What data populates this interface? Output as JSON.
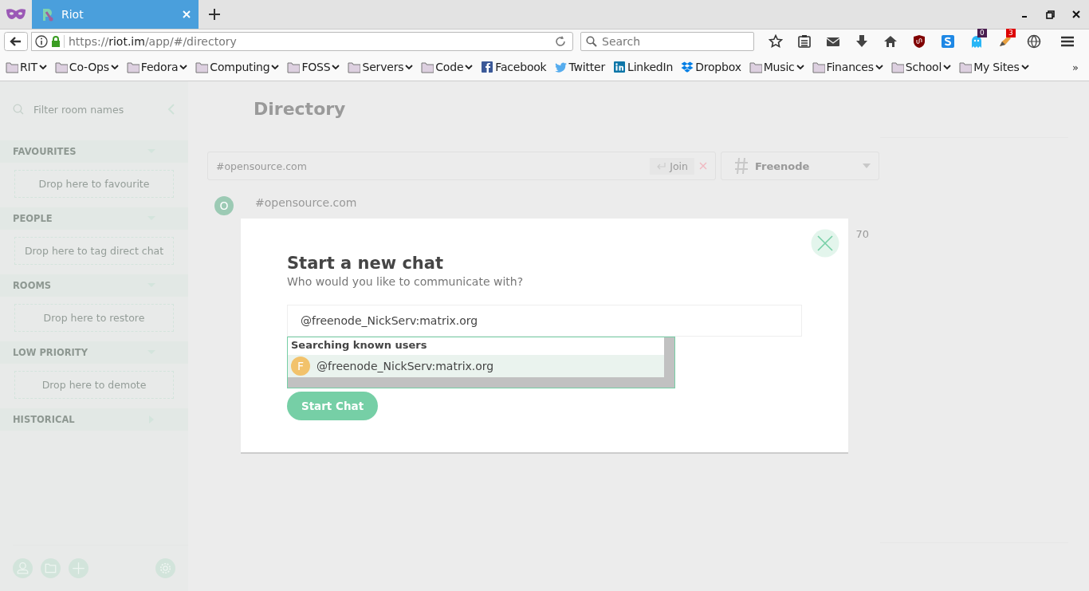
{
  "browser": {
    "tabs": [
      {
        "title": "Riot",
        "selected": true
      }
    ],
    "url": {
      "scheme": "https://",
      "host": "riot.im",
      "path": "/app/#/directory"
    },
    "search": {
      "placeholder": "Search"
    },
    "extension_badges": [
      "0",
      "3"
    ],
    "bookmarks": [
      {
        "kind": "folder",
        "label": "RIT"
      },
      {
        "kind": "folder",
        "label": "Co-Ops"
      },
      {
        "kind": "folder",
        "label": "Fedora"
      },
      {
        "kind": "folder",
        "label": "Computing"
      },
      {
        "kind": "folder",
        "label": "FOSS"
      },
      {
        "kind": "folder",
        "label": "Servers"
      },
      {
        "kind": "folder",
        "label": "Code"
      },
      {
        "kind": "facebook",
        "label": "Facebook"
      },
      {
        "kind": "twitter",
        "label": "Twitter"
      },
      {
        "kind": "linkedin",
        "label": "LinkedIn"
      },
      {
        "kind": "dropbox",
        "label": "Dropbox"
      },
      {
        "kind": "folder",
        "label": "Music"
      },
      {
        "kind": "folder",
        "label": "Finances"
      },
      {
        "kind": "folder",
        "label": "School"
      },
      {
        "kind": "folder",
        "label": "My Sites"
      }
    ],
    "bookmarks_overflow": "»"
  },
  "sidebar": {
    "filter": {
      "placeholder": "Filter room names"
    },
    "sections": [
      {
        "title": "FAVOURITES",
        "expanded": true,
        "drop_text": "Drop here to favourite"
      },
      {
        "title": "PEOPLE",
        "expanded": true,
        "drop_text": "Drop here to tag direct chat"
      },
      {
        "title": "ROOMS",
        "expanded": true,
        "drop_text": "Drop here to restore"
      },
      {
        "title": "LOW PRIORITY",
        "expanded": true,
        "drop_text": "Drop here to demote"
      },
      {
        "title": "HISTORICAL",
        "expanded": false
      }
    ]
  },
  "directory": {
    "title": "Directory",
    "search": {
      "value": "#opensource.com"
    },
    "join": "Join",
    "network": "Freenode",
    "rooms": [
      {
        "avatar": "O",
        "name": "#opensource.com",
        "members": "70"
      }
    ]
  },
  "modal": {
    "title": "Start a new chat",
    "subtitle": "Who would you like to communicate with?",
    "input": {
      "value": "@freenode_NickServ:matrix.org"
    },
    "results_header": "Searching known users",
    "results": [
      {
        "avatar": "F",
        "name": "@freenode_NickServ:matrix.org",
        "selected": true
      }
    ],
    "button": "Start Chat"
  }
}
